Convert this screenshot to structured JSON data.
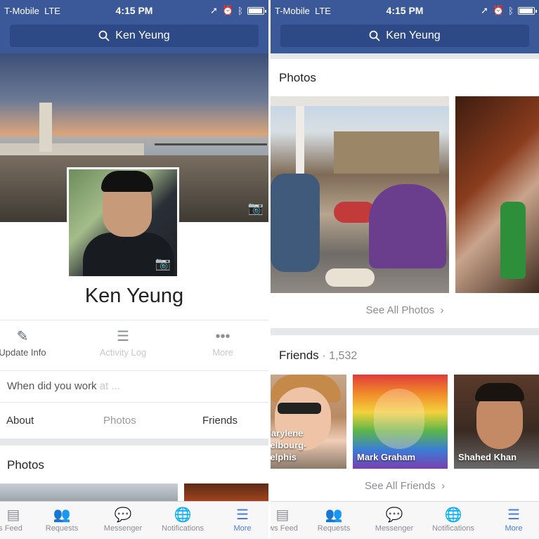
{
  "status_bar": {
    "carrier": "T-Mobile",
    "network": "LTE",
    "time": "4:15 PM"
  },
  "search": {
    "query": "Ken Yeung"
  },
  "profile": {
    "name": "Ken Yeung",
    "actions": [
      {
        "label": "Update Info",
        "icon": "edit-person-icon"
      },
      {
        "label": "Activity Log",
        "icon": "list-icon"
      },
      {
        "label": "More",
        "icon": "more-dots-icon"
      }
    ],
    "prompt": "When did you work",
    "prompt_fade": " at ...",
    "tabs": [
      "About",
      "Photos",
      "Friends"
    ]
  },
  "photos_section": {
    "title": "Photos",
    "see_all": "See All Photos"
  },
  "friends_section": {
    "title": "Friends",
    "count": "1,532",
    "items": [
      {
        "name": "Marylene Delbourg-",
        "name2": "Delphis"
      },
      {
        "name": "Mark Graham",
        "name2": ""
      },
      {
        "name": "Shahed Khan",
        "name2": ""
      }
    ],
    "see_all": "See All Friends"
  },
  "bottom_nav": {
    "items": [
      {
        "label": "News Feed",
        "icon": "feed-icon"
      },
      {
        "label": "Requests",
        "icon": "friends-icon"
      },
      {
        "label": "Messenger",
        "icon": "messenger-icon"
      },
      {
        "label": "Notifications",
        "icon": "globe-icon"
      },
      {
        "label": "More",
        "icon": "hamburger-icon"
      }
    ]
  },
  "colors": {
    "brand": "#3b5998",
    "active_nav": "#4a7be0"
  }
}
